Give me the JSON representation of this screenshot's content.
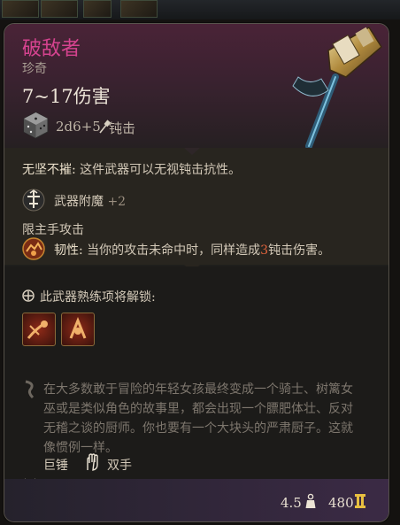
{
  "item": {
    "name": "破敌者",
    "rarity": "珍奇",
    "damage": "7~17伤害",
    "damage_dice": "2d6+5",
    "damage_type": "钝击",
    "colors": {
      "name": "#d5438f",
      "charge": "#e0633c"
    }
  },
  "passives": {
    "unyielding_name": "无坚不摧:",
    "unyielding_desc": "这件武器可以无视钝击抗性。",
    "enchant_label": "武器附魔",
    "enchant_value": "+2",
    "mainhand": "限主手攻击",
    "tenacity_name": "韧性:",
    "tenacity_desc_pre": "当你的攻击未命中时，同样造成",
    "tenacity_value": "3",
    "tenacity_desc_post": "钝击伤害。"
  },
  "proficiency": {
    "title": "此武器熟练项将解锁:",
    "icons": [
      "prof-action-1-icon",
      "prof-action-2-icon"
    ]
  },
  "flavor": "在大多数敢于冒险的年轻女孩最终变成一个骑士、树篱女巫或是类似角色的故事里，都会出现一个膘肥体壮、反对无稽之谈的厨师。你也要有一个大块头的严肃厨子。这就像惯例一样。",
  "properties": {
    "type": "巨锤",
    "handedness": "双手"
  },
  "footer": {
    "weight": "4.5",
    "price": "480"
  }
}
